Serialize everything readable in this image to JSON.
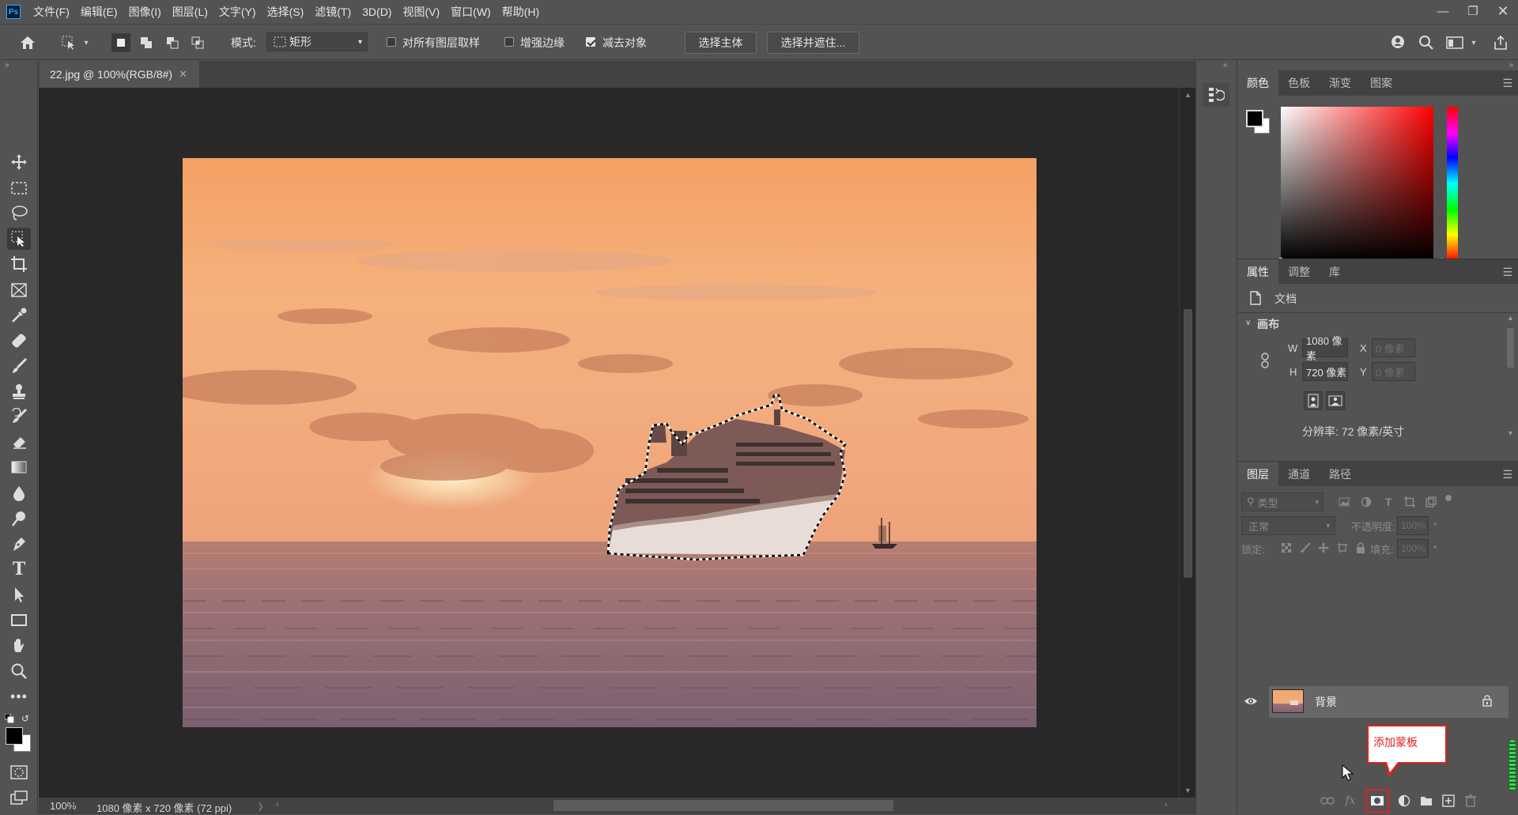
{
  "app": {
    "logo": "Ps",
    "menu": [
      "文件(F)",
      "编辑(E)",
      "图像(I)",
      "图层(L)",
      "文字(Y)",
      "选择(S)",
      "滤镜(T)",
      "3D(D)",
      "视图(V)",
      "窗口(W)",
      "帮助(H)"
    ]
  },
  "options": {
    "mode_label": "模式:",
    "mode_value": "矩形",
    "sample_all_layers": {
      "label": "对所有图层取样",
      "checked": false
    },
    "enhance_edge": {
      "label": "增强边缘",
      "checked": false
    },
    "subtract_object": {
      "label": "减去对象",
      "checked": true
    },
    "select_subject_btn": "选择主体",
    "select_mask_btn": "选择并遮住..."
  },
  "document": {
    "tab_title": "22.jpg @ 100%(RGB/8#)",
    "zoom": "100%",
    "doc_info": "1080 像素 x 720 像素 (72 ppi)"
  },
  "color_panel": {
    "tabs": [
      "颜色",
      "色板",
      "渐变",
      "图案"
    ],
    "active_tab": "颜色",
    "foreground": "#000000",
    "background": "#ffffff",
    "hue": "#ff0000"
  },
  "properties_panel": {
    "tabs": [
      "属性",
      "调整",
      "库"
    ],
    "active_tab": "属性",
    "doc_label": "文档",
    "section": "画布",
    "w_label": "W",
    "w_value": "1080 像素",
    "h_label": "H",
    "h_value": "720 像素",
    "x_label": "X",
    "x_value": "0 像素",
    "y_label": "Y",
    "y_value": "0 像素",
    "resolution": "分辨率: 72 像素/英寸"
  },
  "layers_panel": {
    "tabs": [
      "图层",
      "通道",
      "路径"
    ],
    "active_tab": "图层",
    "filter_placeholder": "类型",
    "blend_mode": "正常",
    "opacity_label": "不透明度:",
    "opacity_value": "100%",
    "lock_label": "锁定:",
    "fill_label": "填充:",
    "fill_value": "100%",
    "layers": [
      {
        "name": "背景",
        "visible": true,
        "locked": true
      }
    ]
  },
  "tooltip": {
    "text": "添加蒙板",
    "border_color": "#e02020"
  },
  "accent": {
    "ps_blue": "#31a8ff"
  }
}
